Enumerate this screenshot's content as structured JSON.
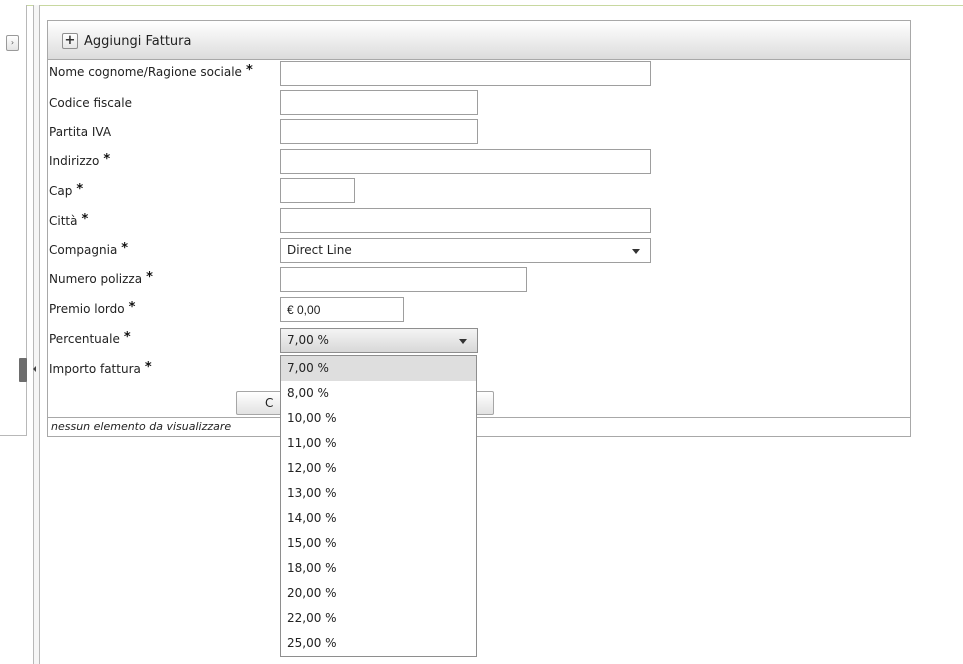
{
  "toolbar": {
    "add_label": "Aggiungi Fattura"
  },
  "form": {
    "nome": {
      "label": "Nome cognome/Ragione sociale",
      "required": "*",
      "value": ""
    },
    "codice_fiscale": {
      "label": "Codice fiscale",
      "value": ""
    },
    "partita_iva": {
      "label": "Partita IVA",
      "value": ""
    },
    "indirizzo": {
      "label": "Indirizzo",
      "required": "*",
      "value": ""
    },
    "cap": {
      "label": "Cap",
      "required": "*",
      "value": ""
    },
    "citta": {
      "label": "Città",
      "required": "*",
      "value": ""
    },
    "compagnia": {
      "label": "Compagnia",
      "required": "*",
      "value": "Direct Line"
    },
    "numero_polizza": {
      "label": "Numero polizza",
      "required": "*",
      "value": ""
    },
    "premio_lordo": {
      "label": "Premio lordo",
      "required": "*",
      "value": "€ 0,00"
    },
    "percentuale": {
      "label": "Percentuale",
      "required": "*",
      "value": "7,00 %"
    },
    "importo_fattura": {
      "label": "Importo fattura",
      "required": "*"
    }
  },
  "confirm_button": {
    "label_visible": "C"
  },
  "footer": {
    "text": "nessun elemento da visualizzare"
  },
  "percentuale_options": [
    "7,00 %",
    "8,00 %",
    "10,00 %",
    "11,00 %",
    "12,00 %",
    "13,00 %",
    "14,00 %",
    "15,00 %",
    "18,00 %",
    "20,00 %",
    "22,00 %",
    "25,00 %"
  ],
  "percentuale_selected": "7,00 %"
}
